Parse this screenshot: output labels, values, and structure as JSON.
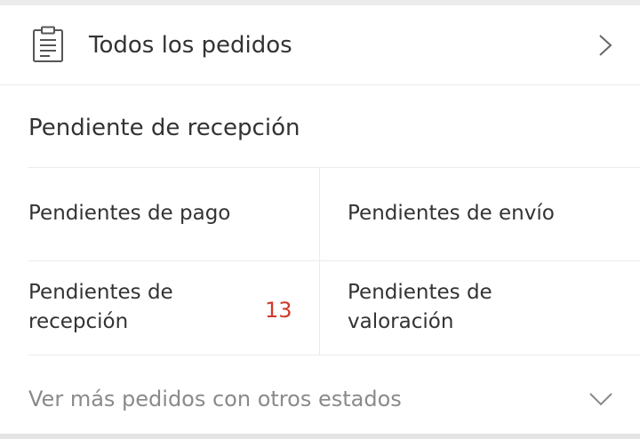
{
  "all_orders": {
    "label": "Todos los pedidos",
    "icon": "clipboard-icon",
    "chevron": "chevron-right-icon"
  },
  "section": {
    "title": "Pendiente de recepción"
  },
  "grid": {
    "pending_payment": "Pendientes de pago",
    "pending_shipment": "Pendientes de envío",
    "pending_receipt_line1": "Pendientes de",
    "pending_receipt_line2": "recepción",
    "pending_receipt_count": "13",
    "pending_review_line1": "Pendientes de",
    "pending_review_line2": "valoración"
  },
  "more": {
    "label": "Ver más pedidos con otros estados",
    "icon": "chevron-down-icon"
  },
  "colors": {
    "badge": "#d0392b",
    "text": "#333333",
    "muted": "#8a8a8a"
  }
}
